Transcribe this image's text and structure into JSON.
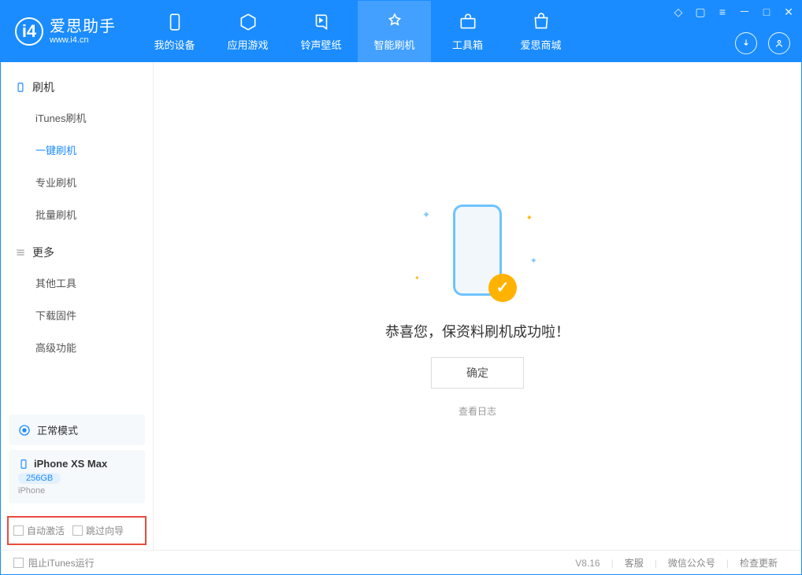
{
  "app": {
    "logo_letter": "i4",
    "title": "爱思助手",
    "subtitle": "www.i4.cn"
  },
  "nav": {
    "tabs": [
      {
        "label": "我的设备"
      },
      {
        "label": "应用游戏"
      },
      {
        "label": "铃声壁纸"
      },
      {
        "label": "智能刷机"
      },
      {
        "label": "工具箱"
      },
      {
        "label": "爱思商城"
      }
    ]
  },
  "sidebar": {
    "section1_title": "刷机",
    "section1_items": [
      "iTunes刷机",
      "一键刷机",
      "专业刷机",
      "批量刷机"
    ],
    "section2_title": "更多",
    "section2_items": [
      "其他工具",
      "下载固件",
      "高级功能"
    ],
    "mode_label": "正常模式",
    "device_name": "iPhone XS Max",
    "device_storage": "256GB",
    "device_type": "iPhone",
    "checkbox1": "自动激活",
    "checkbox2": "跳过向导"
  },
  "main": {
    "success_message": "恭喜您，保资料刷机成功啦！",
    "confirm_button": "确定",
    "view_log": "查看日志"
  },
  "footer": {
    "block_itunes": "阻止iTunes运行",
    "version": "V8.16",
    "links": [
      "客服",
      "微信公众号",
      "检查更新"
    ]
  }
}
